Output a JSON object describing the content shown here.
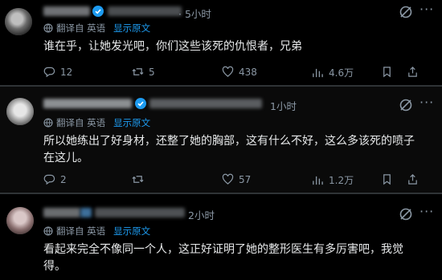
{
  "posts": [
    {
      "time": "· 5小时",
      "translate_label": "翻译自 英语",
      "show_original": "显示原文",
      "text": "谁在乎，让她发光吧，你们这些该死的仇恨者，兄弟",
      "replies": "12",
      "reposts": "5",
      "likes": "438",
      "views": "4.6万"
    },
    {
      "time": "1小时",
      "translate_label": "翻译自 英语",
      "show_original": "显示原文",
      "text": "所以她练出了好身材，还整了她的胸部，这有什么不好，这么多该死的喷子在这儿。",
      "replies": "2",
      "reposts": "",
      "likes": "57",
      "views": "1.2万"
    },
    {
      "time": "2小时",
      "translate_label": "翻译自 英语",
      "show_original": "显示原文",
      "text": "看起来完全不像同一个人，这正好证明了她的整形医生有多厉害吧，我觉得。",
      "replies": "",
      "reposts": "",
      "likes": "",
      "views": ""
    }
  ],
  "icons": {
    "verified": "verified-badge-icon",
    "more": "more-options-icon",
    "grok": "grok-icon",
    "translate": "globe-translate-icon",
    "reply": "reply-icon",
    "repost": "repost-icon",
    "like": "like-icon",
    "views": "views-icon",
    "bookmark": "bookmark-icon",
    "share": "share-icon"
  },
  "colors": {
    "background": "#000000",
    "text": "#e7e9ea",
    "muted": "#8b98a5",
    "accent": "#1d9bf0",
    "divider": "#2f3336"
  }
}
